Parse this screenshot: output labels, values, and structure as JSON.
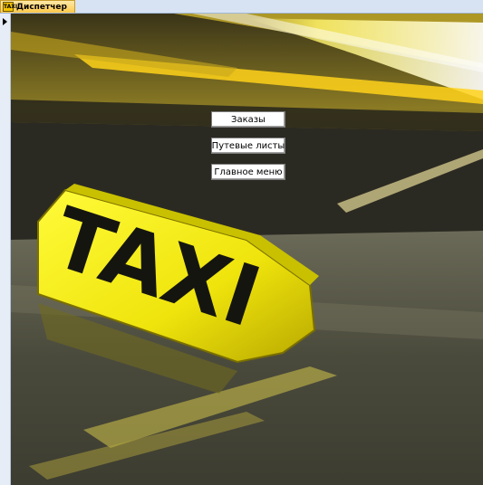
{
  "tab": {
    "title": "Диспетчер",
    "icon": "taxi-form-icon",
    "icon_text": "TAXI"
  },
  "form": {
    "buttons": [
      {
        "label": "Заказы"
      },
      {
        "label": "Путевые листы"
      },
      {
        "label": "Главное меню"
      }
    ],
    "sign_text": "TAXI"
  },
  "colors": {
    "accent": "#f5d400",
    "tab_bg": "#ffc94a",
    "sign_yellow": "#f2e410"
  }
}
